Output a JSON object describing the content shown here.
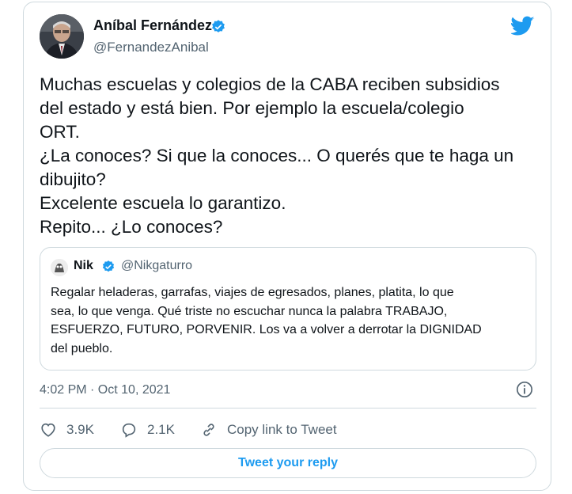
{
  "author": {
    "display_name": "Aníbal Fernández",
    "handle": "@FernandezAnibal",
    "verified": true
  },
  "tweet": {
    "text": "Muchas escuelas y colegios de la CABA reciben subsidios\ndel estado y está bien. Por ejemplo la escuela/colegio\nORT.\n¿La conoces? Si que la conoces... O querés que te haga un\ndibujito?\nExcelente escuela lo garantizo.\nRepito... ¿Lo conoces?",
    "timestamp": "4:02 PM · Oct 10, 2021"
  },
  "quoted_tweet": {
    "display_name": "Nik",
    "handle": "@Nikgaturro",
    "verified": true,
    "text": "Regalar heladeras, garrafas, viajes de egresados, planes, platita, lo que\nsea, lo que venga. Qué triste no escuchar nunca la palabra TRABAJO,\nESFUERZO, FUTURO, PORVENIR. Los va a volver a derrotar la DIGNIDAD\ndel pueblo."
  },
  "actions": {
    "likes": "3.9K",
    "replies": "2.1K",
    "copy_link": "Copy link to Tweet"
  },
  "reply_button": "Tweet your reply",
  "colors": {
    "accent": "#1d9bf0",
    "text": "#0f1419",
    "secondary": "#536471",
    "border": "#cfd9de"
  },
  "icons": [
    "verified-badge-icon",
    "twitter-bird-icon",
    "info-icon",
    "heart-icon",
    "reply-bubble-icon",
    "link-icon"
  ]
}
